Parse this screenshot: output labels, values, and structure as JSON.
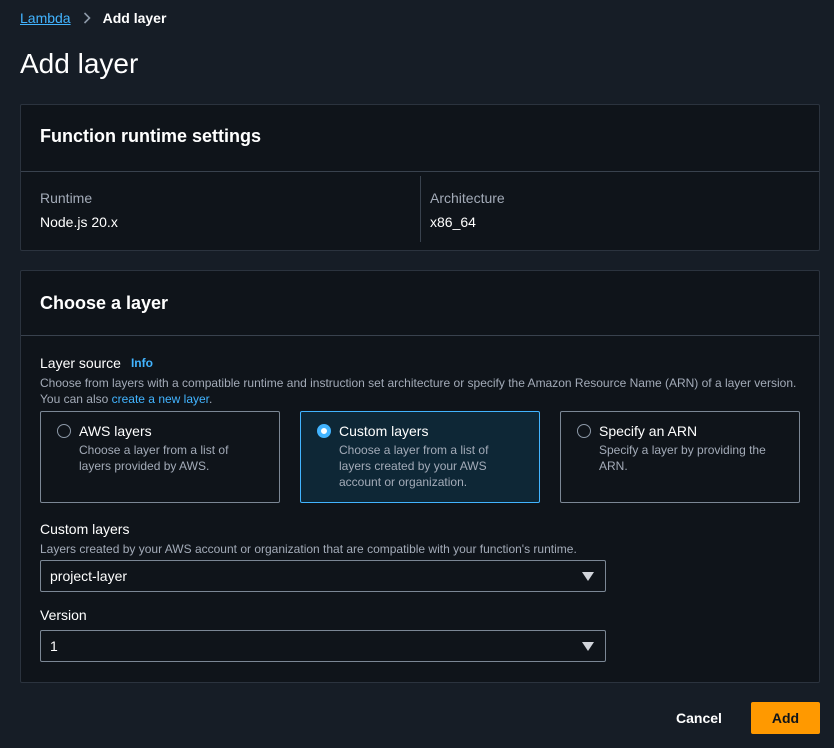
{
  "breadcrumb": {
    "root": "Lambda",
    "current": "Add layer"
  },
  "page": {
    "title": "Add layer"
  },
  "runtime_settings": {
    "title": "Function runtime settings",
    "runtime_label": "Runtime",
    "runtime_value": "Node.js 20.x",
    "architecture_label": "Architecture",
    "architecture_value": "x86_64"
  },
  "choose_layer": {
    "title": "Choose a layer",
    "layer_source_label": "Layer source",
    "info_label": "Info",
    "layer_source_desc": "Choose from layers with a compatible runtime and instruction set architecture or specify the Amazon Resource Name (ARN) of a layer version. You can also ",
    "create_link": "create a new layer",
    "desc_end": ".",
    "options": [
      {
        "title": "AWS layers",
        "desc": "Choose a layer from a list of layers provided by AWS.",
        "selected": false
      },
      {
        "title": "Custom layers",
        "desc": "Choose a layer from a list of layers created by your AWS account or organization.",
        "selected": true
      },
      {
        "title": "Specify an ARN",
        "desc": "Specify a layer by providing the ARN.",
        "selected": false
      }
    ],
    "custom_layers_label": "Custom layers",
    "custom_layers_desc": "Layers created by your AWS account or organization that are compatible with your function's runtime.",
    "custom_layers_value": "project-layer",
    "version_label": "Version",
    "version_value": "1"
  },
  "actions": {
    "cancel": "Cancel",
    "add": "Add"
  },
  "colors": {
    "accent": "#42b4ff",
    "primary_button": "#ff9900",
    "background": "#161d26",
    "panel": "#0f141a"
  }
}
